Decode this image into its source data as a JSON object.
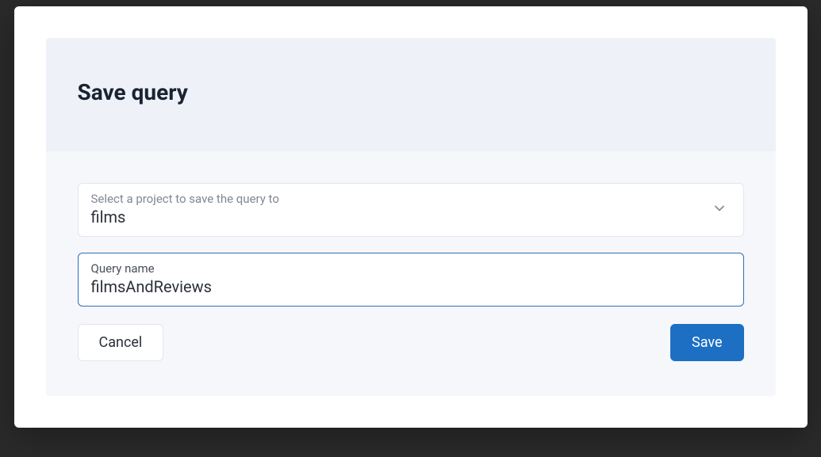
{
  "dialog": {
    "title": "Save query"
  },
  "projectSelect": {
    "label": "Select a project to save the query to",
    "value": "films"
  },
  "queryName": {
    "label": "Query name",
    "value": "filmsAndReviews"
  },
  "buttons": {
    "cancel": "Cancel",
    "save": "Save"
  }
}
